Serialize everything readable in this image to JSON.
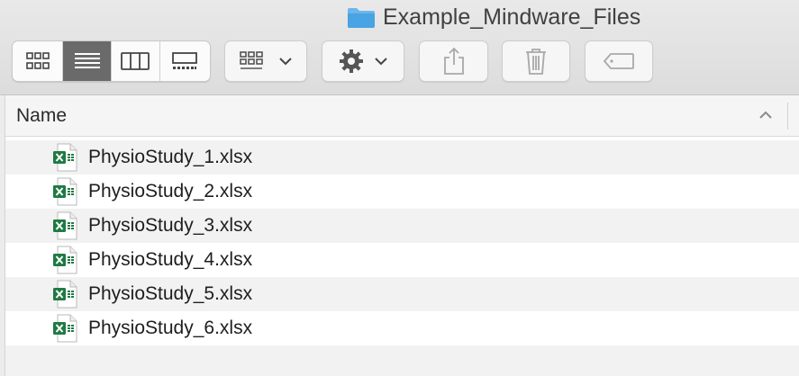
{
  "window": {
    "title": "Example_Mindware_Files"
  },
  "toolbar": {
    "view_modes": [
      {
        "name": "icon-view",
        "active": false
      },
      {
        "name": "list-view",
        "active": true
      },
      {
        "name": "column-view",
        "active": false
      },
      {
        "name": "gallery-view",
        "active": false
      }
    ],
    "icons": [
      "grid-icon",
      "list-icon",
      "columns-icon",
      "gallery-icon",
      "group-icon",
      "gear-icon",
      "share-icon",
      "trash-icon",
      "tag-icon"
    ]
  },
  "list": {
    "columns": [
      {
        "label": "Name",
        "sorted": "ascending"
      }
    ],
    "files": [
      {
        "name": "PhysioStudy_1.xlsx"
      },
      {
        "name": "PhysioStudy_2.xlsx"
      },
      {
        "name": "PhysioStudy_3.xlsx"
      },
      {
        "name": "PhysioStudy_4.xlsx"
      },
      {
        "name": "PhysioStudy_5.xlsx"
      },
      {
        "name": "PhysioStudy_6.xlsx"
      }
    ]
  },
  "colors": {
    "folder": "#5aa9e6",
    "excel": "#1f7a43",
    "active_segment": "#6a6a6a"
  }
}
